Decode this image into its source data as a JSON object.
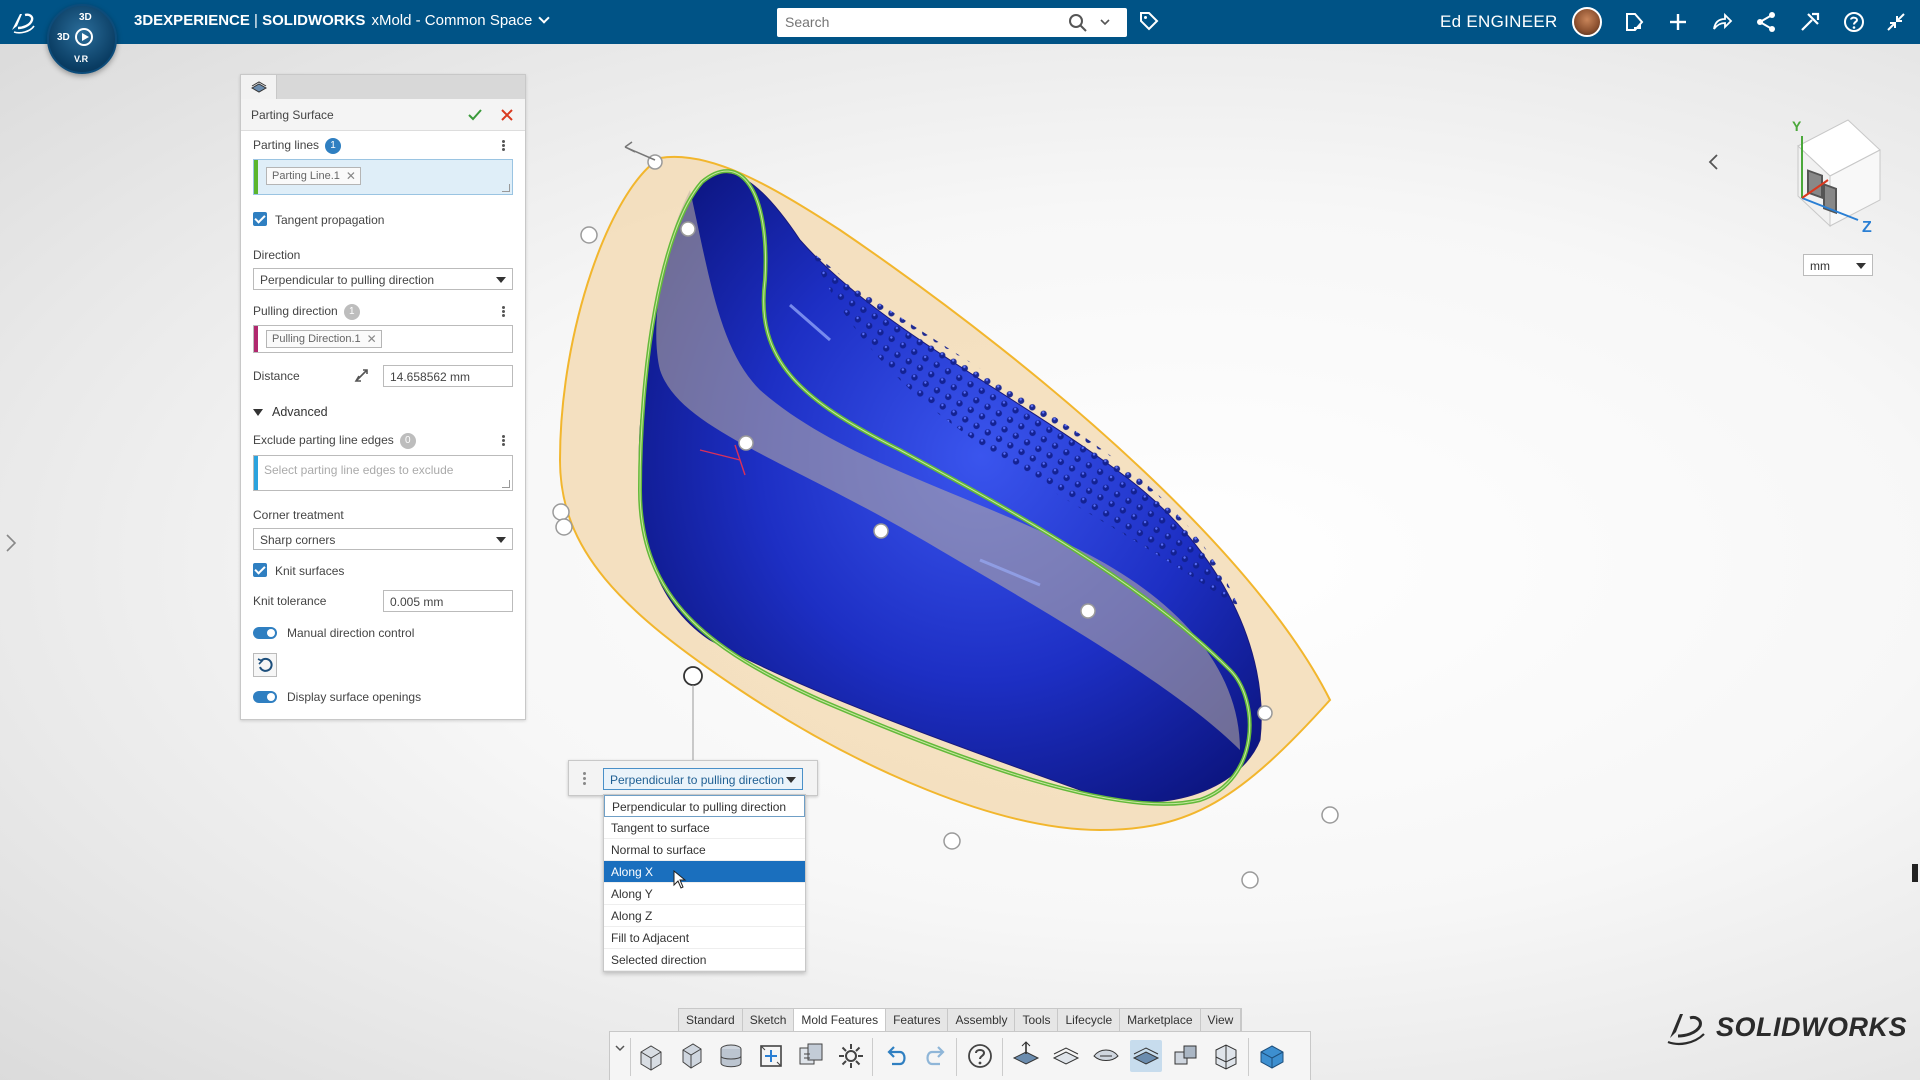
{
  "topbar": {
    "title_3dx": "3DEXPERIENCE",
    "title_sep": " | ",
    "title_product": "SOLIDWORKS",
    "title_space": "xMold - Common Space",
    "search_placeholder": "Search",
    "user_name": "Ed ENGINEER",
    "compass_top": "3D",
    "compass_left": "3D",
    "compass_version": "V.R",
    "brand_color": "#005386"
  },
  "panel": {
    "title": "Parting Surface",
    "parting_lines_label": "Parting lines",
    "parting_lines_count": "1",
    "parting_line_chip": "Parting Line.1",
    "tangent_propagation_label": "Tangent propagation",
    "direction_label": "Direction",
    "direction_value": "Perpendicular to pulling direction",
    "pulling_direction_label": "Pulling direction",
    "pulling_direction_count": "1",
    "pulling_direction_chip": "Pulling Direction.1",
    "distance_label": "Distance",
    "distance_value": "14.658562 mm",
    "advanced_label": "Advanced",
    "exclude_label": "Exclude parting line edges",
    "exclude_count": "0",
    "exclude_placeholder": "Select parting line edges to exclude",
    "corner_label": "Corner treatment",
    "corner_value": "Sharp corners",
    "knit_surfaces_label": "Knit surfaces",
    "knit_tolerance_label": "Knit tolerance",
    "knit_tolerance_value": "0.005 mm",
    "manual_direction_label": "Manual direction control",
    "display_openings_label": "Display surface openings"
  },
  "context": {
    "selected": "Perpendicular to pulling direction",
    "options": [
      "Perpendicular to pulling direction",
      "Tangent to surface",
      "Normal to surface",
      "Along X",
      "Along Y",
      "Along Z",
      "Fill to Adjacent",
      "Selected direction"
    ],
    "highlighted": "Along X"
  },
  "viewport": {
    "units": "mm",
    "axis_y": "Y",
    "axis_z": "Z",
    "model_color": "#1f33c8",
    "surface_color": "#f1d9b0",
    "parting_line_color": "#5bb52d"
  },
  "toolbar": {
    "tabs": [
      "Standard",
      "Sketch",
      "Mold Features",
      "Features",
      "Assembly",
      "Tools",
      "Lifecycle",
      "Marketplace",
      "View"
    ],
    "active_tab": "Mold Features"
  },
  "branding": {
    "logo_text": "SOLIDWORKS"
  }
}
